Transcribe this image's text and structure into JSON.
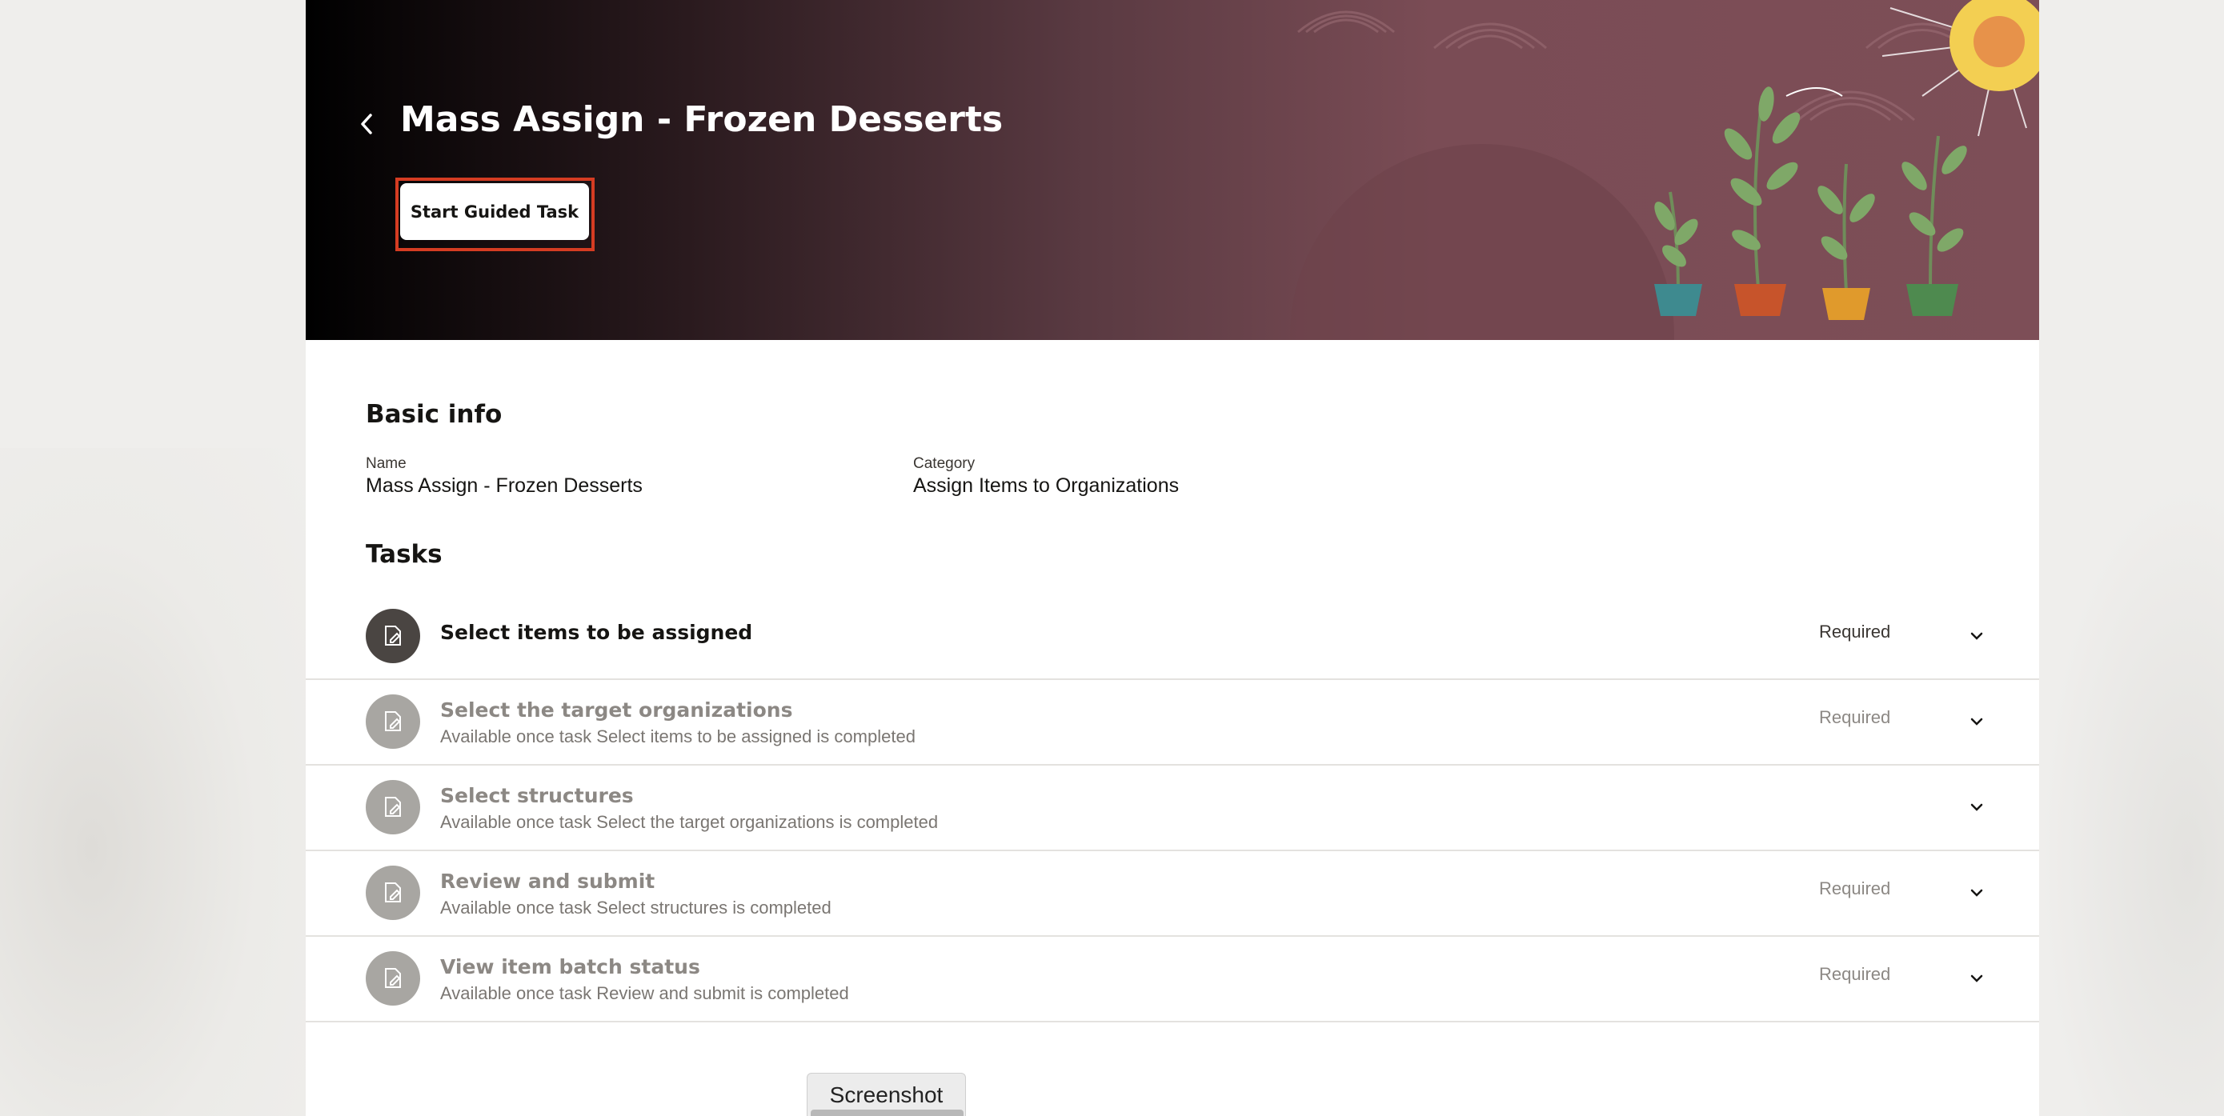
{
  "header": {
    "back_icon": "chevron-left-icon",
    "title": "Mass Assign - Frozen Desserts",
    "start_button": "Start Guided Task"
  },
  "basic_info": {
    "heading": "Basic info",
    "name_label": "Name",
    "name_value": "Mass Assign - Frozen Desserts",
    "category_label": "Category",
    "category_value": "Assign Items to Organizations"
  },
  "tasks": {
    "heading": "Tasks",
    "items": [
      {
        "title": "Select items to be assigned",
        "subtitle": "",
        "status": "Required",
        "active": true
      },
      {
        "title": "Select the target organizations",
        "subtitle": "Available once task Select items to be assigned is completed",
        "status": "Required",
        "active": false
      },
      {
        "title": "Select structures",
        "subtitle": "Available once task Select the target organizations is completed",
        "status": "",
        "active": false
      },
      {
        "title": "Review and submit",
        "subtitle": "Available once task Select structures is completed",
        "status": "Required",
        "active": false
      },
      {
        "title": "View item batch status",
        "subtitle": "Available once task Review and submit is completed",
        "status": "Required",
        "active": false
      }
    ]
  },
  "overlay": {
    "tab_label": "Screenshot"
  },
  "colors": {
    "highlight": "#d53c22",
    "hero_bg": "#7d4e57",
    "active_icon": "#4a4542",
    "inactive_icon": "#a8a6a2"
  }
}
